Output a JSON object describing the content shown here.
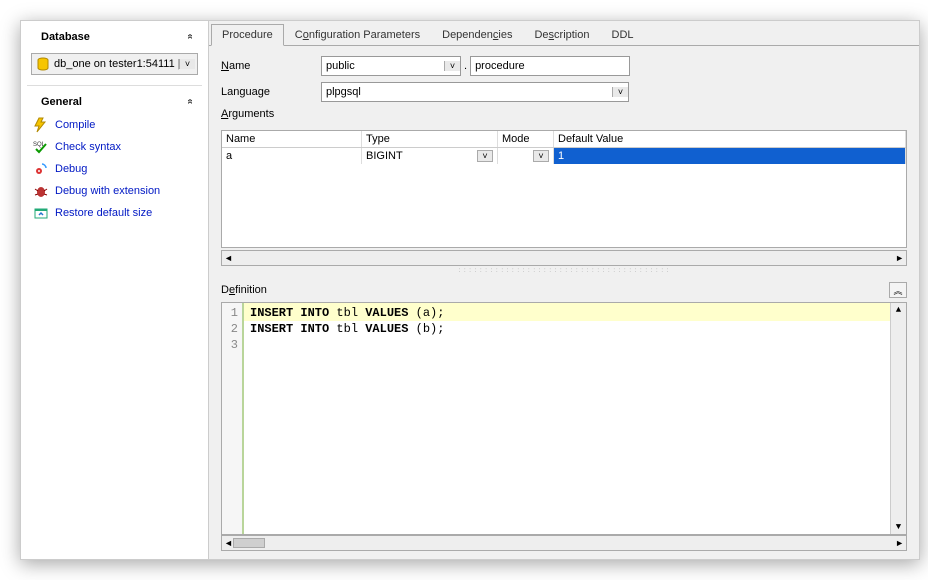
{
  "sidebar": {
    "sections": {
      "database": {
        "title": "Database"
      },
      "general": {
        "title": "General"
      }
    },
    "db_selector": {
      "text": "db_one on tester1:54111 |"
    },
    "items": [
      {
        "label": "Compile"
      },
      {
        "label": "Check syntax"
      },
      {
        "label": "Debug"
      },
      {
        "label": "Debug with extension"
      },
      {
        "label": "Restore default size"
      }
    ]
  },
  "tabs": [
    {
      "label": "Procedure",
      "active": true
    },
    {
      "label": "Configuration Parameters"
    },
    {
      "label": "Dependencies"
    },
    {
      "label": "Description"
    },
    {
      "label": "DDL"
    }
  ],
  "form": {
    "name_label": "Name",
    "schema_value": "public",
    "proc_name_value": "procedure",
    "language_label": "Language",
    "language_value": "plpgsql",
    "arguments_label": "Arguments"
  },
  "args": {
    "headers": {
      "name": "Name",
      "type": "Type",
      "mode": "Mode",
      "def": "Default Value"
    },
    "rows": [
      {
        "name": "a",
        "type": "BIGINT",
        "mode": "",
        "def": "1"
      }
    ]
  },
  "definition": {
    "label": "Definition",
    "lines": [
      "INSERT INTO tbl VALUES (a);",
      "INSERT INTO tbl VALUES (b);",
      ""
    ],
    "line_numbers": [
      "1",
      "2",
      "3"
    ]
  }
}
